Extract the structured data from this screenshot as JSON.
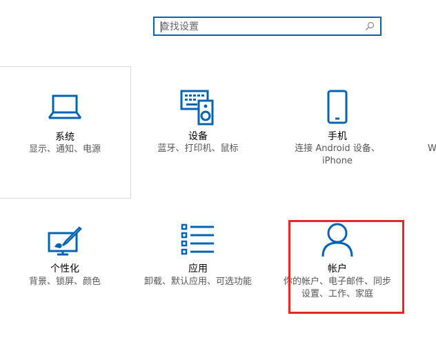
{
  "search": {
    "placeholder": "查找设置"
  },
  "tiles": [
    {
      "title": "系统",
      "desc": "显示、通知、电源",
      "icon": "laptop-icon"
    },
    {
      "title": "设备",
      "desc": "蓝牙、打印机、鼠标",
      "icon": "keyboard-speaker-icon"
    },
    {
      "title": "手机",
      "desc_line1": "连接 Android 设备、",
      "desc_line2": "iPhone",
      "icon": "phone-icon"
    },
    {
      "title": "个性化",
      "desc": "背景、锁屏、颜色",
      "icon": "monitor-brush-icon"
    },
    {
      "title": "应用",
      "desc": "卸载、默认应用、可选功能",
      "icon": "list-icon"
    },
    {
      "title": "帐户",
      "desc_line1": "你的帐户、电子邮件、同步",
      "desc_line2": "设置、工作、家庭",
      "icon": "person-icon"
    }
  ],
  "partial_next_tile_letter": "W",
  "colors": {
    "accent": "#0063b1",
    "highlight": "#e02a2a",
    "selection_border": "#d9d9d9"
  }
}
